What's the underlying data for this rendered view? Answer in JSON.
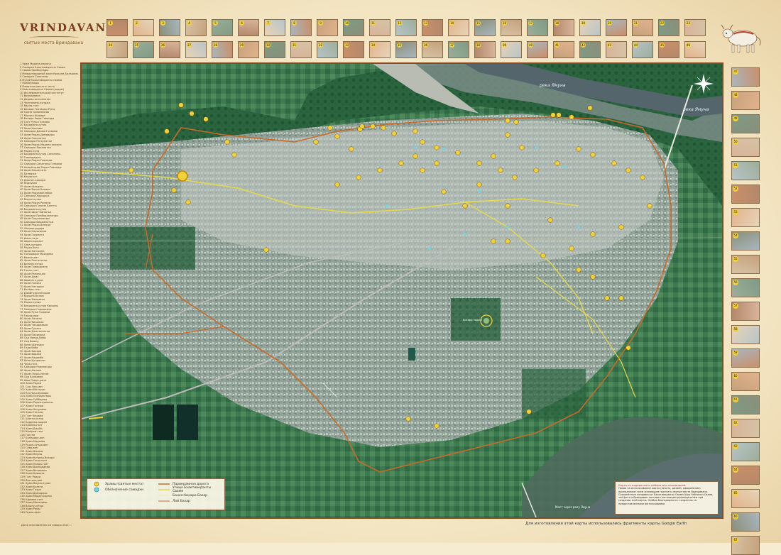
{
  "logo": {
    "title": "VRINDAVANA",
    "subtitle": "святые места Вриндавана"
  },
  "top_row_1": [
    "1",
    "2",
    "3",
    "4",
    "5",
    "6",
    "7",
    "8",
    "9",
    "10",
    "11",
    "12",
    "13",
    "14",
    "15",
    "16",
    "17",
    "18",
    "19",
    "20",
    "21",
    "22",
    "23"
  ],
  "top_row_2": [
    "24",
    "25",
    "26",
    "27",
    "28",
    "29",
    "30",
    "31",
    "32",
    "33",
    "34",
    "35",
    "36",
    "37",
    "38",
    "39",
    "40",
    "41",
    "42",
    "43",
    "44",
    "45",
    "46"
  ],
  "side_column": [
    "47",
    "48",
    "49",
    "50",
    "51",
    "52",
    "53",
    "54",
    "55",
    "56",
    "57",
    "58",
    "59",
    "60",
    "61",
    "62",
    "63",
    "64",
    "65",
    "66",
    "67",
    "68",
    "69",
    "70"
  ],
  "map_labels": {
    "river_1": "река Ямуна",
    "river_2": "река Ямуна",
    "center_label": "Бихари ладжи",
    "bridge_label": "Мост через реку Ямуна"
  },
  "legend_items": [
    "1  Храм Мадана-мохана",
    "2  Самадхи Бхактиведанты Свами",
    "3  Свами Прабхупады",
    "4  Международный храм Кришна-Баларамы",
    "5  Самадхи Санатаны",
    "6  Музей Бхактиведанты Свами",
    "7  Прабхупады",
    "8  Памятное место в честь",
    "9  Бхактиведанты Свами (рядом)",
    "10  Исследовательский институт",
    "11  Вриндавана",
    "12  Дерево исполнения",
    "13  Чинтамани-кунджа",
    "14  Варна-гхат",
    "15  Бихари Гхатвары Рупы",
    "16  Тропа паломников",
    "17  Мочака Ишвара",
    "18  Бихари Рамы Говинды",
    "19  Гхат Рупы Госвами",
    "20  Бхаджана-кутир",
    "21  Храм Кешавы",
    "22  Самадхи Джива Госвами",
    "23  Храм Радха-Дамодары",
    "24  Храм Гопинатхи",
    "25  Самадхи Рагхунатхи",
    "26  Храм Радха-Мадана-мохана",
    "27  Самадхи Локанатхи",
    "28  Радха-кунд",
    "29  Бхаджана-кутир Санатаны",
    "30  Говиндаджи",
    "31  Храм Радха-Говинды",
    "32  Самадхи Санатаны Госвами",
    "33  Новый храм Радха-Говинды",
    "34  Храм Кешигхата",
    "35  Баладжи",
    "36  Кешигхат",
    "37  Джагат-кишора",
    "38  Нидхуван",
    "39  Храм Шахджи",
    "40  Храм Банке Бихари",
    "41  Храм Радхаваллабхи",
    "42  Самадхи Харидаса",
    "43  Ямуна-пулин",
    "44  Храм Радха-Раманы",
    "45  Самадхи Гопала Бхатты",
    "46  Бхаджана-кутир",
    "47  Храм Шри Чайтаньи",
    "48  Самадхи Прабодхананды",
    "49  Храм Гокулананды",
    "50  Самадхи Вишванатхи",
    "51  Храм Радха-Винода",
    "52  Шьямасундара",
    "53  Храм Нарасимхи",
    "54  Храм Гауранги",
    "55  Имли-тала",
    "56  Шрингара-ват",
    "57  Сева-кунджа",
    "58  Радха-бага",
    "59  Храм Катьяяни",
    "60  Гопишвара Махадева",
    "61  Вамши-ват",
    "62  Храм Ранганатхи",
    "63  Брахма-кунда",
    "64  Храм Говардхана",
    "65  Гопал-гхат",
    "66  Храм Раманудж",
    "67  Храм Даму",
    "68  Шринатх-джи",
    "69  Храм Голока",
    "70  Храм Натхджи",
    "71  Бихари-гхат",
    "72  Джайпурский храм",
    "73  Кришна-балам",
    "74  Храм Камьяван",
    "75  Радха-кунда",
    "76  Бхаджана-кутир Кришны",
    "77  Самадхи Гададхары",
    "78  Храм Рупа Госвами",
    "79  Гиридхари",
    "80  Храм Лалиты",
    "81  Храм Вишакхи",
    "82  Храм Чандравали",
    "83  Храм Сухаси",
    "84  Храм Джаганнатхи",
    "85  Храм Паримала",
    "86  Сад Нанда-бабы",
    "87  Сад Вишну",
    "88  Храм Шанкара",
    "89  Гиди-баба",
    "90  Храм Бихари",
    "91  Храм Варахи",
    "92  Храм Кадамба",
    "93  Храм Кундаллы",
    "94  Чира-гхат",
    "95  Самадхи Рамананды",
    "96  Храм Канака",
    "97  Храм Гаура-Нитай",
    "98  Сад Баладева",
    "99  Шри Радха-рани",
    "100  Храм Радхи",
    "101  Сад Лакшми",
    "102  Храм Матхуры",
    "103  Кусума-саровара",
    "104  Храм Панчаватары",
    "105  Храм Суббаджи",
    "106  Храм Радха-кришны",
    "107  Храм Ганеши",
    "108  Храм Ханумана",
    "109  Храм Гопалы",
    "110  Гхат Кешава",
    "111  Шанти-кутир",
    "112  Бадрика-ашрам",
    "113  Брахма-гхат",
    "114  Храм Джуйи",
    "115  Вишрам-гхат",
    "116  Гокула",
    "117  Бхандира-ван",
    "118  Храм Мадхава",
    "119  Радха-кунда-ван",
    "120  Сева-ван",
    "121  Храм Шьямы",
    "122  Храм Ямуны",
    "123  Храм Кунджа-бихари",
    "124  Храм Гопи-ната",
    "125  Храм Нанда-гхат",
    "126  Храм Вриндадеви",
    "127  Храм Ванамали",
    "128  Храм Кришны",
    "129  Гхат Радхи",
    "130  Ватсала-ван",
    "131  Храм Ямуна-пулин",
    "132  Храм Бхакти",
    "133  Храм Гаура",
    "134  Храм Дамодары",
    "135  Храм Мадхусуданы",
    "136  Шриван-гхат",
    "137  Храм Махаламы",
    "138  Вишну-кунда",
    "139  Храм Рамы",
    "140  Радха-ванн"
  ],
  "key": {
    "temples": "Храмы (святые места)",
    "samadhi": "Обозначение самадхи",
    "parikrama": "Парикрамная дорога",
    "bhaktivedanta_street": "Улица Бхактиведанты Свами",
    "banke_bazaar": "Банке-бихари Базар",
    "loi_bazaar": "Лой Базар"
  },
  "note": {
    "title": "Карта из подарочного набора для паломников:",
    "text": "Права на использование карты (печать, дизайн, оформление) принадлежат всем желающим посетить святые места Вриндавана. Сохранённые поправки от Бхактиведанты Свами Шри Чайтаньи Свами, чьё фото и Вриндаван поставил настоящим руководителем при создании этой карты. Особая благодарность: создатель со предоставленными фотографиями."
  },
  "footer_right": "Для изготовления этой карты использовались фрагменты карты Google Earth",
  "footer_left": "Дата изготовления 15 января 2011 г.",
  "colors": {
    "frame": "#8b4a1e",
    "pin": "#f2d03a",
    "parikrama": "#c86a2a",
    "street": "#e6d94a",
    "samadhi": "#6fd6e8"
  }
}
